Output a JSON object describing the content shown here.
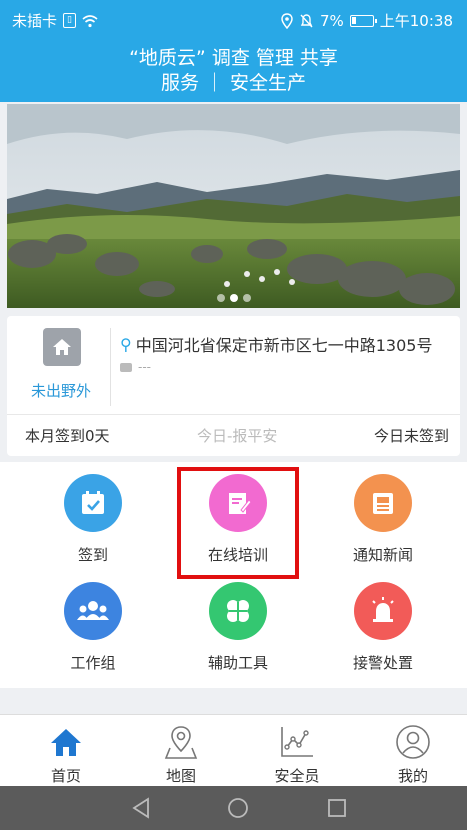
{
  "status_bar": {
    "carrier": "未插卡",
    "battery_pct": "7%",
    "time": "上午10:38",
    "icons": [
      "sim-icon",
      "wifi-icon",
      "location-icon",
      "silent-icon",
      "battery-icon"
    ]
  },
  "header": {
    "line1": "“地质云” 调查 管理 共享",
    "line2": "服务 ｜ 安全生产"
  },
  "banner": {
    "slide_count": 3,
    "active_slide": 2
  },
  "status_card": {
    "status_label": "未出野外",
    "location": "中国河北省保定市新市区七一中路1305号",
    "brief_text": "---",
    "signin_month": "本月签到0天",
    "report_safe": "今日-报平安",
    "signin_today": "今日未签到"
  },
  "features": [
    {
      "label": "签到",
      "color": "#3aa3e6",
      "icon": "calendar-check-icon"
    },
    {
      "label": "在线培训",
      "color": "#f26ad0",
      "icon": "edit-note-icon"
    },
    {
      "label": "通知新闻",
      "color": "#f3924f",
      "icon": "newspaper-icon"
    },
    {
      "label": "工作组",
      "color": "#3d84e0",
      "icon": "group-icon"
    },
    {
      "label": "辅助工具",
      "color": "#34c771",
      "icon": "clover-icon"
    },
    {
      "label": "接警处置",
      "color": "#f25b58",
      "icon": "alarm-icon"
    }
  ],
  "bottom_nav": {
    "items": [
      {
        "label": "首页",
        "icon": "home-icon",
        "active": true
      },
      {
        "label": "地图",
        "icon": "map-icon",
        "active": false
      },
      {
        "label": "安全员",
        "icon": "chart-icon",
        "active": false
      },
      {
        "label": "我的",
        "icon": "profile-icon",
        "active": false
      }
    ]
  },
  "system_nav": [
    "back-icon",
    "home-circle-icon",
    "recents-icon"
  ],
  "colors": {
    "accent": "#29a8e6",
    "highlight": "#e10f10"
  }
}
